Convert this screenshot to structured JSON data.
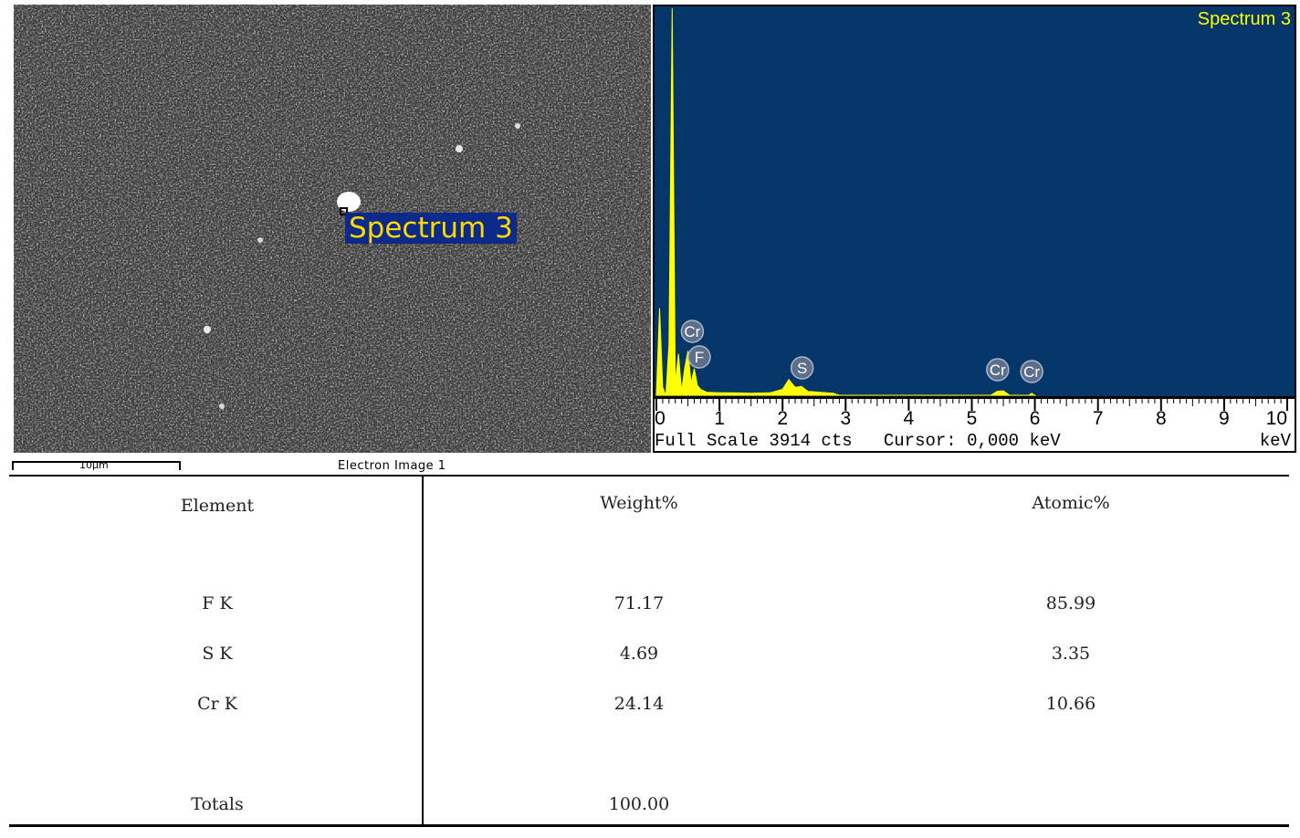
{
  "sem_image": {
    "caption": "Electron Image 1",
    "scale_bar_label": "10µm",
    "spectrum_marker_label": "Spectrum 3"
  },
  "eds": {
    "title": "Spectrum 3",
    "full_scale_text": "Full Scale 3914 cts",
    "cursor_text": "Cursor: 0,000 keV",
    "unit_label": "keV",
    "background_color": "#05366a",
    "trace_color": "#ffff00",
    "peak_labels": [
      "Cr",
      "F",
      "S",
      "Cr",
      "Cr"
    ]
  },
  "chart_data": {
    "type": "area",
    "title": "Spectrum 3",
    "xlabel": "keV",
    "ylabel": "",
    "xlim": [
      0,
      10
    ],
    "ylim": [
      0,
      3914
    ],
    "x_ticks": [
      "0",
      "1",
      "2",
      "3",
      "4",
      "5",
      "6",
      "7",
      "8",
      "9",
      "10"
    ],
    "series": [
      {
        "x": [
          0.0,
          0.05,
          0.1,
          0.15,
          0.2,
          0.25,
          0.3,
          0.35,
          0.4,
          0.45,
          0.5,
          0.55,
          0.6,
          0.65,
          0.7,
          0.8,
          1.0,
          1.2,
          1.5,
          1.8,
          2.0,
          2.1,
          2.2,
          2.3,
          2.4,
          2.6,
          2.8,
          2.9,
          5.3,
          5.4,
          5.5,
          5.6,
          5.9,
          5.95,
          6.0
        ],
        "values": [
          0,
          880,
          80,
          0,
          520,
          3914,
          120,
          420,
          40,
          280,
          450,
          120,
          270,
          100,
          60,
          30,
          25,
          25,
          20,
          25,
          60,
          160,
          80,
          90,
          40,
          30,
          20,
          0,
          0,
          40,
          45,
          0,
          0,
          20,
          0
        ]
      }
    ],
    "peaks": [
      {
        "label": "Cr",
        "energy_keV": 0.57
      },
      {
        "label": "F",
        "energy_keV": 0.68
      },
      {
        "label": "S",
        "energy_keV": 2.31
      },
      {
        "label": "Cr",
        "energy_keV": 5.41
      },
      {
        "label": "Cr",
        "energy_keV": 5.95
      }
    ]
  },
  "table": {
    "headers": [
      "Element",
      "Weight%",
      "Atomic%"
    ],
    "rows": [
      [
        "F K",
        "71.17",
        "85.99"
      ],
      [
        "S K",
        "4.69",
        "3.35"
      ],
      [
        "Cr K",
        "24.14",
        "10.66"
      ]
    ],
    "totals": [
      "Totals",
      "100.00",
      ""
    ]
  }
}
